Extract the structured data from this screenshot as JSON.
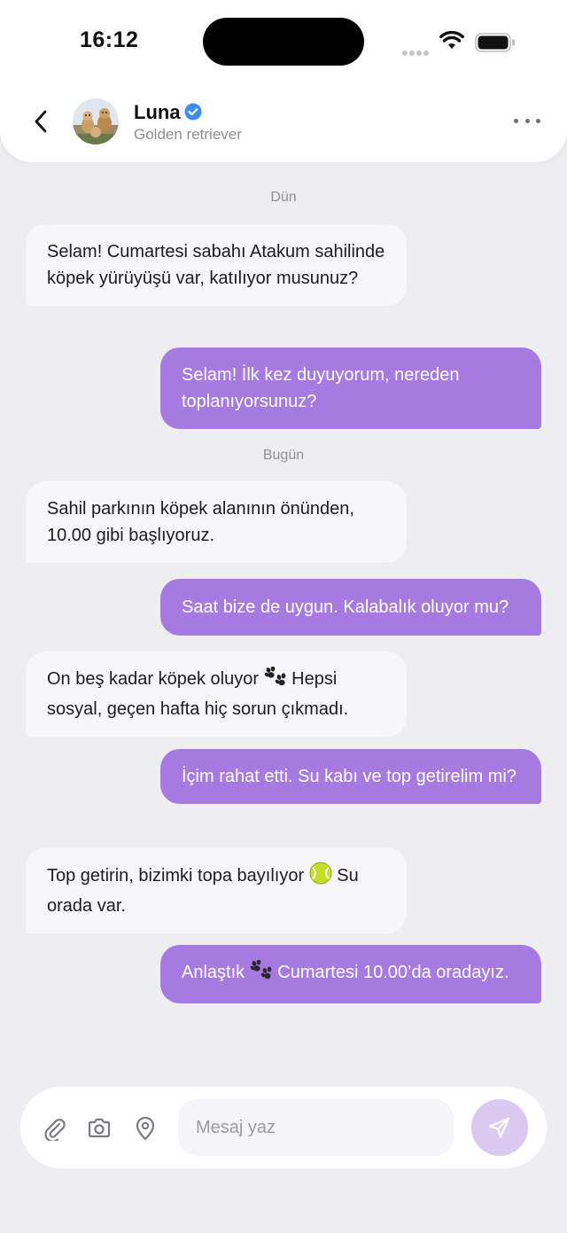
{
  "status_bar": {
    "time": "16:12"
  },
  "header": {
    "contact_name": "Luna",
    "contact_subtitle": "Golden retriever",
    "verified_color": "#3b8cf3"
  },
  "colors": {
    "accent": "#a67ae0",
    "send_button": "#dcc9f2",
    "incoming_bubble": "#f7f7fa",
    "background": "#eeeef1"
  },
  "messages": [
    {
      "type": "day",
      "text": "Dün"
    },
    {
      "type": "in",
      "text": "Selam! Cumartesi sabahı Atakum sahilinde köpek yürüyüşü var, katılıyor musunuz?"
    },
    {
      "type": "out",
      "text": "Selam! İlk kez duyuyorum, nereden toplanıyorsunuz?"
    },
    {
      "type": "day",
      "text": "Bugün"
    },
    {
      "type": "in",
      "text": "Sahil parkının köpek alanının önünden, 10.00 gibi başlıyoruz."
    },
    {
      "type": "out",
      "text": "Saat bize de uygun. Kalabalık oluyor mu?"
    },
    {
      "type": "in",
      "text_before": "On beş kadar köpek oluyor",
      "emoji": "paw-prints",
      "text_after": "Hepsi sosyal, geçen hafta hiç sorun çıkmadı."
    },
    {
      "type": "out",
      "text": "İçim rahat etti. Su kabı ve top getirelim mi?"
    },
    {
      "type": "in",
      "text_before": "Top getirin, bizimki topa bayılıyor",
      "emoji": "tennis-ball",
      "text_after": "Su orada var."
    },
    {
      "type": "out",
      "text_before": "Anlaştık",
      "emoji": "paw-prints",
      "text_after": "Cumartesi 10.00’da oradayız."
    }
  ],
  "composer": {
    "placeholder": "Mesaj yaz",
    "icons": [
      "paperclip-icon",
      "camera-icon",
      "location-pin-icon",
      "send-icon"
    ]
  }
}
